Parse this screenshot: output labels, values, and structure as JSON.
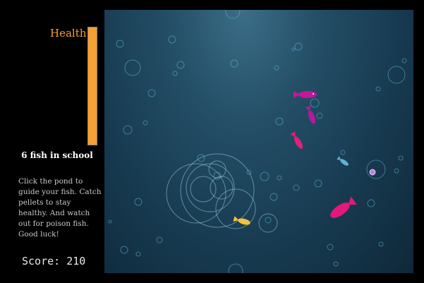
{
  "sidebar": {
    "health_label": "Health",
    "health_level": 1.0,
    "school_count": "6 fish in school",
    "instructions": "Click the pond to guide your fish. Catch pellets to stay healthy. And watch out for poison fish. Good luck!",
    "score": "Score: 210"
  },
  "colors": {
    "health": "#f5a030",
    "pond": "#1c4660",
    "school_fish_magenta": "#c2189a",
    "school_fish_pink": "#e6177a",
    "poison_fish": "#f2c33a",
    "blue_fish": "#5fb0d8",
    "pellet": "#c080e8"
  }
}
